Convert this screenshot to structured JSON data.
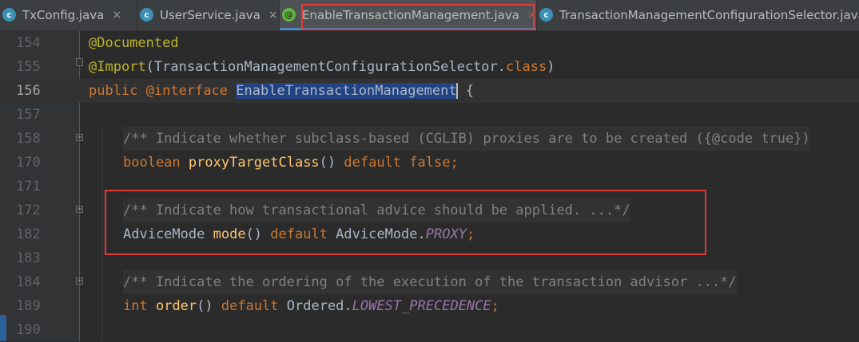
{
  "tabs": [
    {
      "label": "TxConfig.java",
      "icon": "class-icon",
      "active": false
    },
    {
      "label": "UserService.java",
      "icon": "class-icon",
      "active": false
    },
    {
      "label": "EnableTransactionManagement.java",
      "icon": "annotation-icon",
      "active": true
    },
    {
      "label": "TransactionManagementConfigurationSelector.java",
      "icon": "class-icon",
      "active": false
    }
  ],
  "close_glyph": "×",
  "icon_letters": {
    "class": "c",
    "annotation": "@"
  },
  "lines": [
    {
      "num": "154",
      "tokens": [
        "@Documented"
      ]
    },
    {
      "num": "155",
      "tokens": [
        "@Import",
        "(",
        "TransactionManagementConfigurationSelector",
        ".",
        "class",
        ")"
      ]
    },
    {
      "num": "156",
      "tokens": [
        "public",
        " ",
        "@interface",
        " ",
        "EnableTransactionManagement",
        " {"
      ]
    },
    {
      "num": "157",
      "tokens": []
    },
    {
      "num": "158",
      "tokens": [
        "/** Indicate whether subclass-based (CGLIB) proxies are to be created ({@code true})"
      ]
    },
    {
      "num": "170",
      "tokens": [
        "boolean",
        " ",
        "proxyTargetClass",
        "() ",
        "default",
        " ",
        "false",
        ";"
      ]
    },
    {
      "num": "171",
      "tokens": []
    },
    {
      "num": "172",
      "tokens": [
        "/** Indicate how transactional advice should be applied. ...*/"
      ]
    },
    {
      "num": "182",
      "tokens": [
        "AdviceMode",
        " ",
        "mode",
        "() ",
        "default",
        " AdviceMode.",
        "PROXY",
        ";"
      ]
    },
    {
      "num": "183",
      "tokens": []
    },
    {
      "num": "184",
      "tokens": [
        "/** Indicate the ordering of the execution of the transaction advisor ...*/"
      ]
    },
    {
      "num": "189",
      "tokens": [
        "int",
        " ",
        "order",
        "() ",
        "default",
        " Ordered.",
        "LOWEST_PRECEDENCE",
        ";"
      ]
    },
    {
      "num": "190",
      "tokens": []
    }
  ],
  "colors": {
    "editor_bg": "#2b2b2b",
    "gutter_bg": "#313335",
    "annotation": "#bbb529",
    "keyword": "#cc7832",
    "method": "#ffc66d",
    "static_field": "#9876aa",
    "comment": "#808080",
    "selection": "#214283",
    "highlight_box": "#e53935"
  }
}
